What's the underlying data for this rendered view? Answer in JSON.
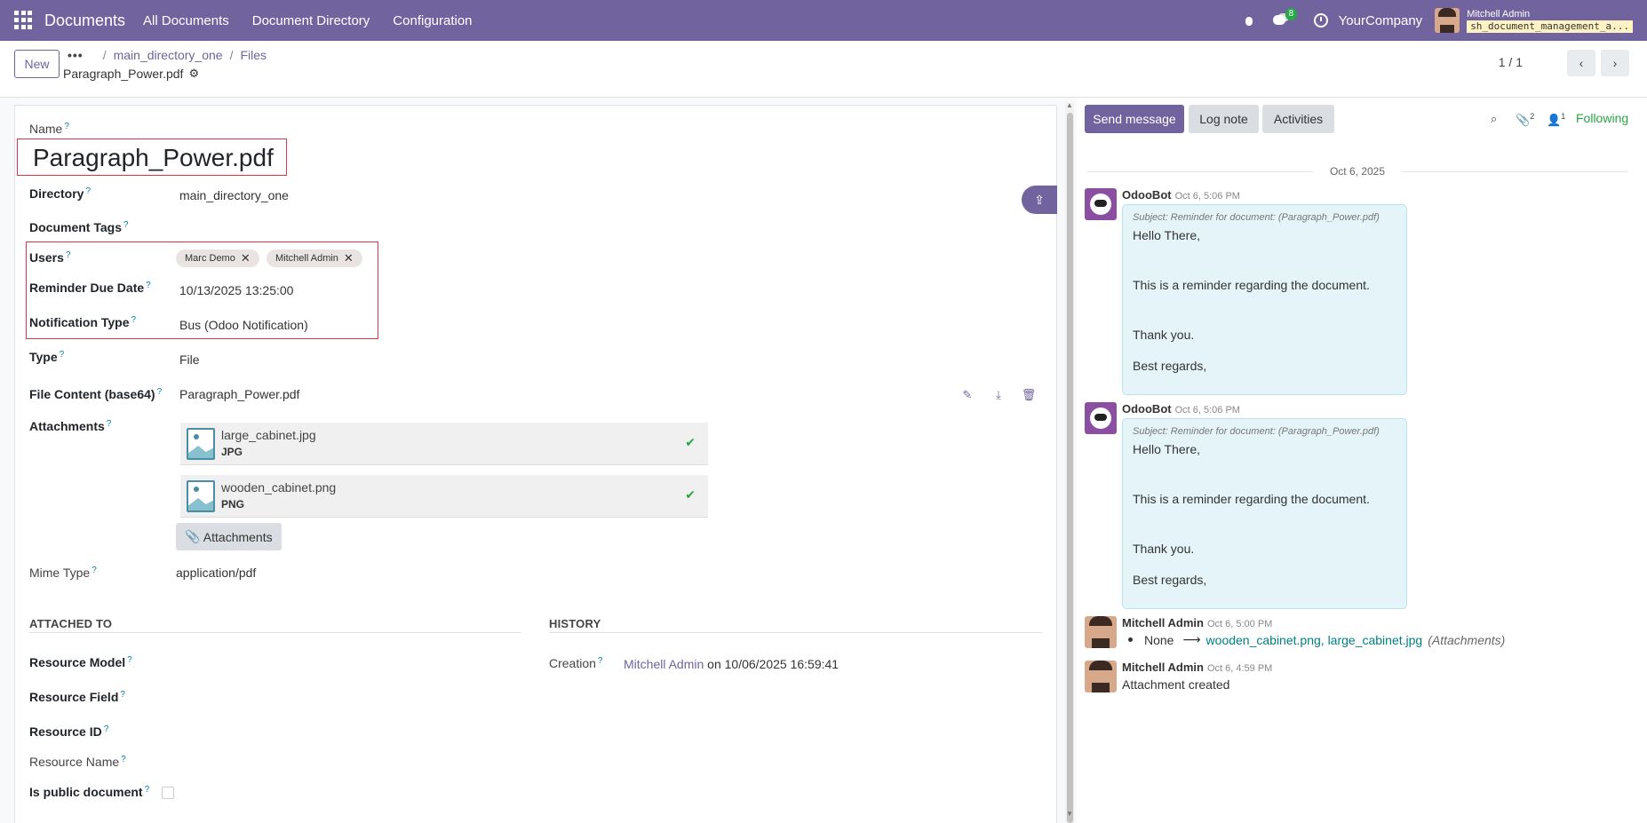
{
  "topbar": {
    "app_name": "Documents",
    "menu": [
      "All Documents",
      "Document Directory",
      "Configuration"
    ],
    "messages_count": "8",
    "company": "YourCompany",
    "user_name": "Mitchell Admin",
    "db_name": "sh_document_management_a..."
  },
  "control": {
    "new_label": "New",
    "breadcrumb_dots": "•••",
    "breadcrumbs": [
      "main_directory_one",
      "Files"
    ],
    "record_title": "Paragraph_Power.pdf",
    "pager": "1 / 1"
  },
  "form": {
    "name_label": "Name",
    "name_value": "Paragraph_Power.pdf",
    "directory_label": "Directory",
    "directory_value": "main_directory_one",
    "tags_label": "Document Tags",
    "users_label": "Users",
    "users": [
      "Marc Demo",
      "Mitchell Admin"
    ],
    "reminder_label": "Reminder Due Date",
    "reminder_value": "10/13/2025 13:25:00",
    "notification_label": "Notification Type",
    "notification_value": "Bus (Odoo Notification)",
    "type_label": "Type",
    "type_value": "File",
    "file_content_label": "File Content (base64)",
    "file_content_value": "Paragraph_Power.pdf",
    "attachments_label": "Attachments",
    "attachments": [
      {
        "name": "large_cabinet.jpg",
        "ext": "JPG"
      },
      {
        "name": "wooden_cabinet.png",
        "ext": "PNG"
      }
    ],
    "attachments_button": "Attachments",
    "mime_label": "Mime Type",
    "mime_value": "application/pdf",
    "attached_to_title": "ATTACHED TO",
    "history_title": "HISTORY",
    "resource_model_label": "Resource Model",
    "resource_field_label": "Resource Field",
    "resource_id_label": "Resource ID",
    "resource_name_label": "Resource Name",
    "public_label": "Is public document",
    "creation_label": "Creation",
    "creation_user": "Mitchell Admin",
    "creation_rest": "on 10/06/2025 16:59:41"
  },
  "chatter": {
    "send_message": "Send message",
    "log_note": "Log note",
    "activities": "Activities",
    "attachments_count": "2",
    "followers_count": "1",
    "following": "Following",
    "date_separator": "Oct 6, 2025",
    "messages": [
      {
        "author": "OdooBot",
        "time": "Oct 6, 5:06 PM",
        "subject": "Subject: Reminder for document: (Paragraph_Power.pdf)",
        "lines": [
          "Hello There,",
          "This is a reminder regarding the document.",
          "Thank you.",
          "Best regards,"
        ]
      },
      {
        "author": "OdooBot",
        "time": "Oct 6, 5:06 PM",
        "subject": "Subject: Reminder for document: (Paragraph_Power.pdf)",
        "lines": [
          "Hello There,",
          "This is a reminder regarding the document.",
          "Thank you.",
          "Best regards,"
        ]
      },
      {
        "author": "Mitchell Admin",
        "time": "Oct 6, 5:00 PM",
        "tracking_old": "None",
        "tracking_new_1": "wooden_cabinet.png",
        "tracking_new_2": "large_cabinet.jpg",
        "tracking_field": "(Attachments)"
      },
      {
        "author": "Mitchell Admin",
        "time": "Oct 6, 4:59 PM",
        "body": "Attachment created"
      }
    ]
  },
  "colors": {
    "brand": "#71639e",
    "highlight": "#dc3545",
    "following": "#28a745"
  }
}
